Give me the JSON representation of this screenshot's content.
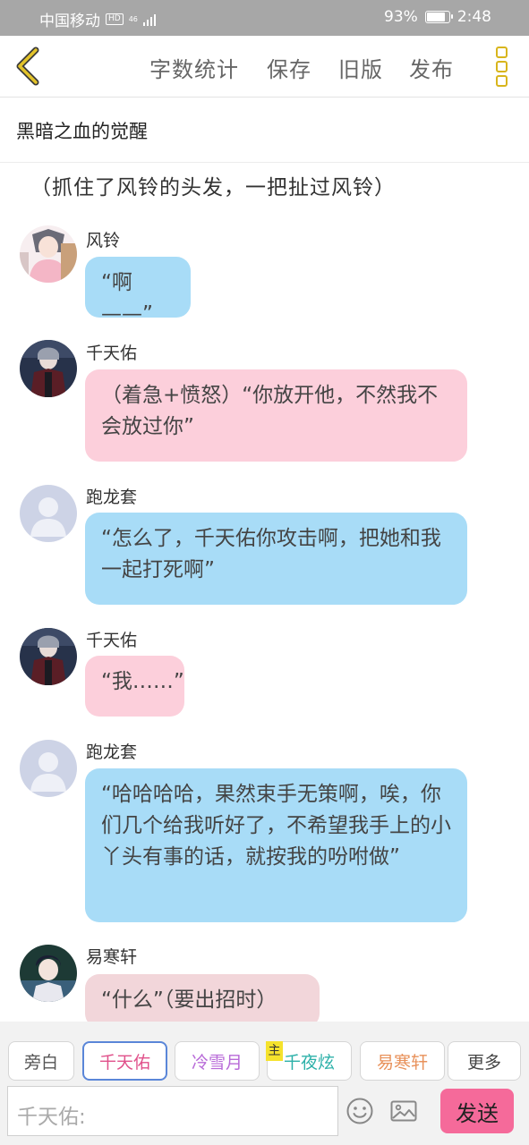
{
  "status_bar": {
    "carrier": "中国移动",
    "hd": "HD",
    "network": "46",
    "battery": "93%",
    "battery_level": 0.93,
    "time": "2:48"
  },
  "toolbar": {
    "word_count": "字数统计",
    "save": "保存",
    "old_version": "旧版",
    "publish": "发布"
  },
  "story_title": "黑暗之血的觉醒",
  "narration": "（抓住了风铃的头发，一把扯过风铃）",
  "messages": [
    {
      "sender": "风铃",
      "text": "“啊——”"
    },
    {
      "sender": "千天佑",
      "text": "（着急+愤怒）“你放开他，不然我不会放过你”"
    },
    {
      "sender": "跑龙套",
      "text": "“怎么了，千天佑你攻击啊，把她和我一起打死啊”"
    },
    {
      "sender": "千天佑",
      "text": "“我……”"
    },
    {
      "sender": "跑龙套",
      "text": "“哈哈哈哈，果然束手无策啊，唉，你们几个给我听好了，不希望我手上的小丫头有事的话，就按我的吩咐做”"
    },
    {
      "sender": "易寒轩",
      "text": "“什么”（要出招时）"
    }
  ],
  "roles": [
    {
      "label": "旁白",
      "color": "#555555"
    },
    {
      "label": "千天佑",
      "color": "#e0508a"
    },
    {
      "label": "冷雪月",
      "color": "#b86ad8"
    },
    {
      "label": "千夜炫",
      "color": "#2bb0a8"
    },
    {
      "label": "易寒轩",
      "color": "#e8915a"
    },
    {
      "label": "更多",
      "color": "#444444"
    }
  ],
  "host_badge": "主",
  "input": {
    "placeholder": "千天佑:"
  },
  "send": "发送"
}
